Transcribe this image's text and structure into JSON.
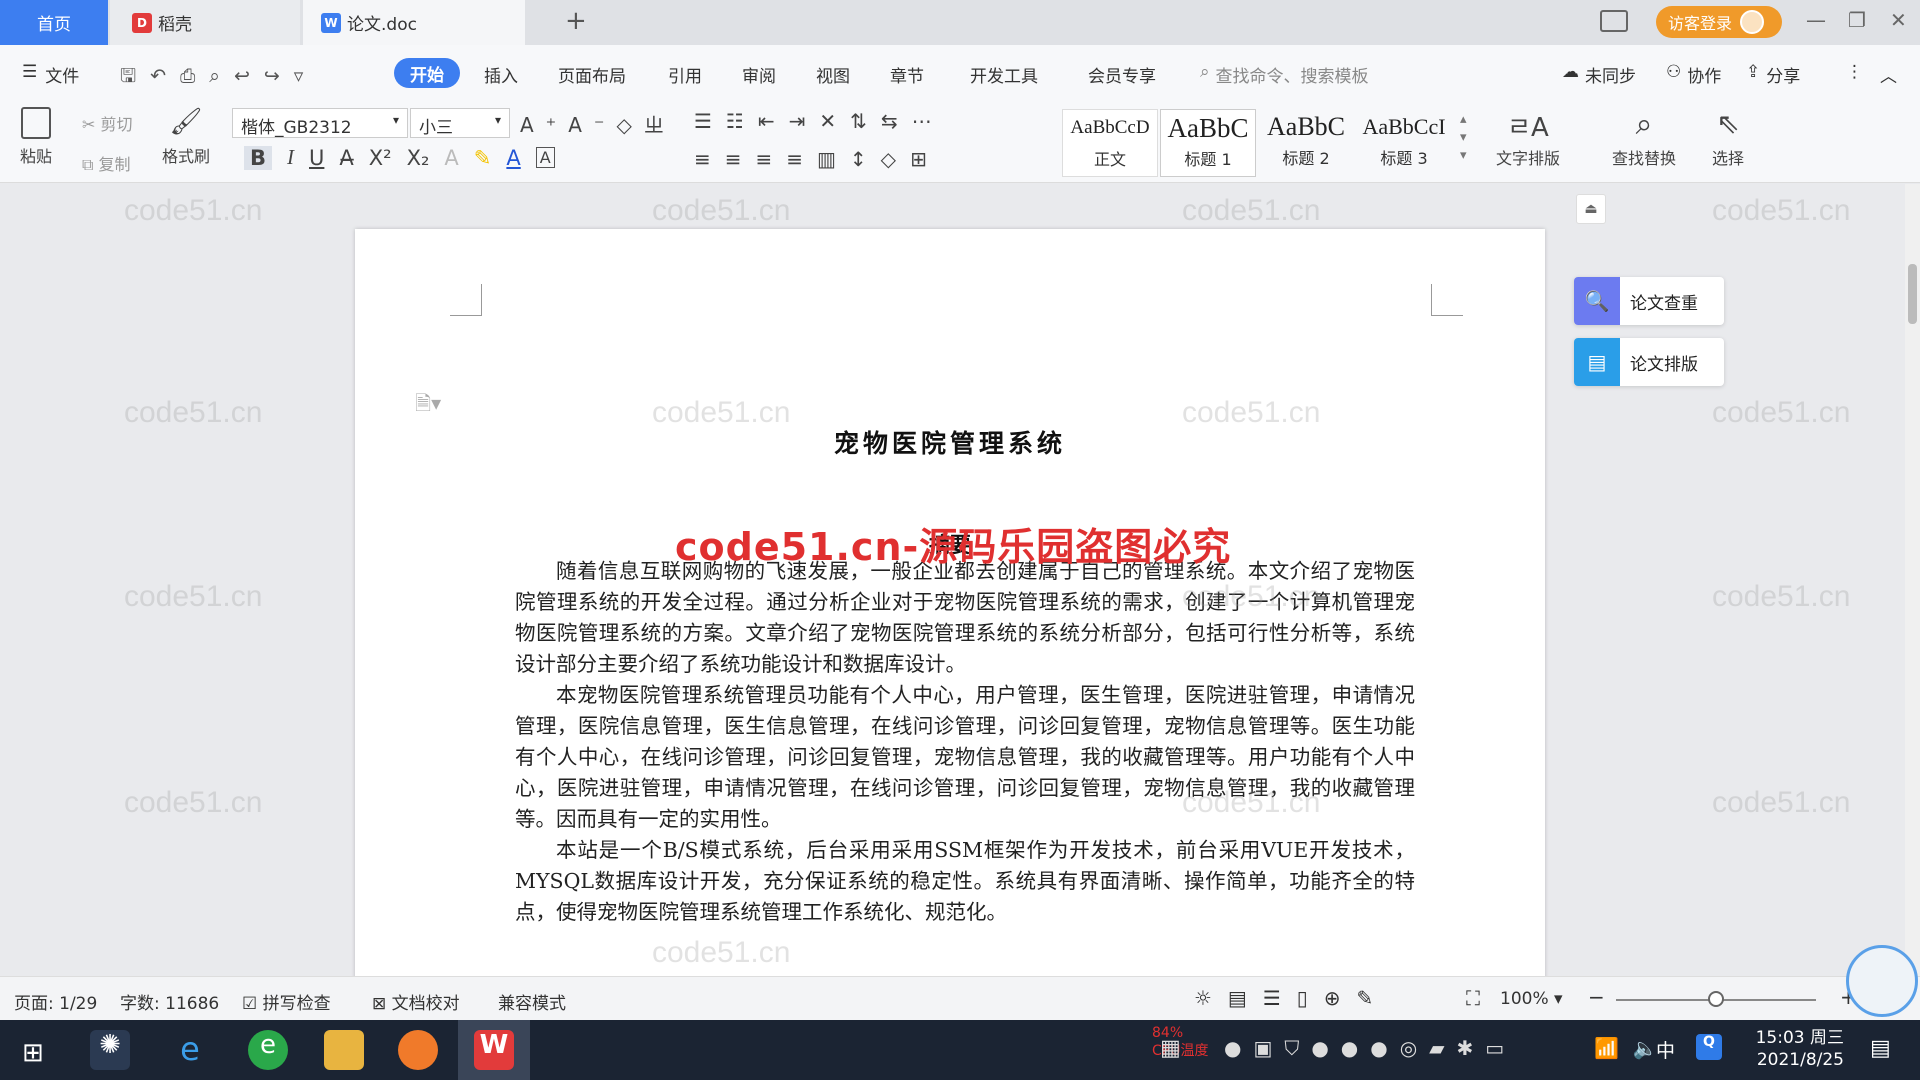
{
  "tabs": {
    "home": "首页",
    "daoke": "稻壳",
    "doc": "论文.doc",
    "new_tab": "+",
    "login": "访客登录"
  },
  "menu": {
    "file": "文件",
    "items": [
      "开始",
      "插入",
      "页面布局",
      "引用",
      "审阅",
      "视图",
      "章节",
      "开发工具",
      "会员专享"
    ],
    "search_placeholder": "查找命令、搜索模板",
    "unsync": "未同步",
    "collab": "协作",
    "share": "分享"
  },
  "toolbar": {
    "paste": "粘贴",
    "cut": "剪切",
    "copy": "复制",
    "format_painter": "格式刷",
    "font_name": "楷体_GB2312",
    "font_size": "小三",
    "styles": [
      {
        "preview": "AaBbCcD",
        "label": "正文"
      },
      {
        "preview": "AaBbC",
        "label": "标题 1"
      },
      {
        "preview": "AaBbC",
        "label": "标题 2"
      },
      {
        "preview": "AaBbCcI",
        "label": "标题 3"
      }
    ],
    "text_layout": "文字排版",
    "find_replace": "查找替换",
    "select": "选择"
  },
  "document": {
    "title": "宠物医院管理系统",
    "abstract_label": "摘要",
    "overlay_watermark": "code51.cn-源码乐园盗图必究",
    "paragraphs": [
      "随着信息互联网购物的飞速发展，一般企业都去创建属于自己的管理系统。本文介绍了宠物医院管理系统的开发全过程。通过分析企业对于宠物医院管理系统的需求，创建了一个计算机管理宠物医院管理系统的方案。文章介绍了宠物医院管理系统的系统分析部分，包括可行性分析等，系统设计部分主要介绍了系统功能设计和数据库设计。",
      "本宠物医院管理系统管理员功能有个人中心，用户管理，医生管理，医院进驻管理，申请情况管理，医院信息管理，医生信息管理，在线问诊管理，问诊回复管理，宠物信息管理等。医生功能有个人中心，在线问诊管理，问诊回复管理，宠物信息管理，我的收藏管理等。用户功能有个人中心，医院进驻管理，申请情况管理，在线问诊管理，问诊回复管理，宠物信息管理，我的收藏管理等。因而具有一定的实用性。",
      "本站是一个B/S模式系统，后台采用采用SSM框架作为开发技术，前台采用VUE开发技术，MYSQL数据库设计开发，充分保证系统的稳定性。系统具有界面清晰、操作简单，功能齐全的特点，使得宠物医院管理系统管理工作系统化、规范化。"
    ],
    "site_watermark": "code51.cn"
  },
  "side_panel": {
    "check": "论文查重",
    "layout": "论文排版"
  },
  "status": {
    "page": "页面: 1/29",
    "words": "字数: 11686",
    "spell": "拼写检查",
    "proof": "文档校对",
    "compat": "兼容模式",
    "zoom": "100%"
  },
  "taskbar": {
    "cpu": "84%",
    "cpu_label": "CPU温度",
    "ime": "中",
    "time": "15:03 周三",
    "date": "2021/8/25"
  },
  "colors": {
    "accent": "#3d7ef0",
    "login": "#f09a2a",
    "watermark_red": "#e03030"
  }
}
